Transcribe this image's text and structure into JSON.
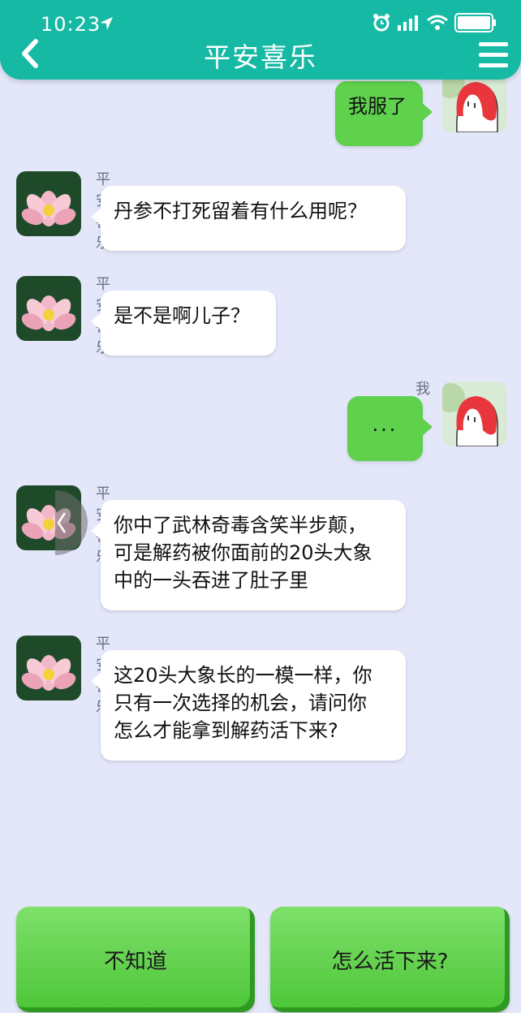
{
  "status_bar": {
    "time": "10:23"
  },
  "header": {
    "title": "平安喜乐"
  },
  "messages": [
    {
      "side": "right",
      "sender": "",
      "text": "我服了"
    },
    {
      "side": "left",
      "sender": "平安喜乐",
      "text": "丹参不打死留着有什么用呢？"
    },
    {
      "side": "left",
      "sender": "平安喜乐",
      "text": "是不是啊儿子？"
    },
    {
      "side": "right",
      "sender": "我",
      "text": "..."
    },
    {
      "side": "left",
      "sender": "平安喜乐",
      "lines": [
        "你中了武林奇毒含笑半步颠，",
        "可是解药被你面前的20头大象",
        "中的一头吞进了肚子里"
      ]
    },
    {
      "side": "left",
      "sender": "平安喜乐",
      "lines": [
        "这20头大象长的一模一样，你",
        "只有一次选择的机会，请问你",
        "怎么才能拿到解药活下来?"
      ]
    }
  ],
  "choices": [
    "不知道",
    "怎么活下来?"
  ],
  "colors": {
    "header": "#16b9a4",
    "background": "#e4e7fa",
    "bubble_self": "#5fd14d",
    "button": "#5fd14d"
  },
  "icons": [
    "location-arrow-icon",
    "alarm-icon",
    "signal-icon",
    "wifi-icon",
    "battery-icon",
    "back-arrow-icon",
    "menu-icon",
    "lotus-avatar",
    "cartoon-avatar"
  ]
}
